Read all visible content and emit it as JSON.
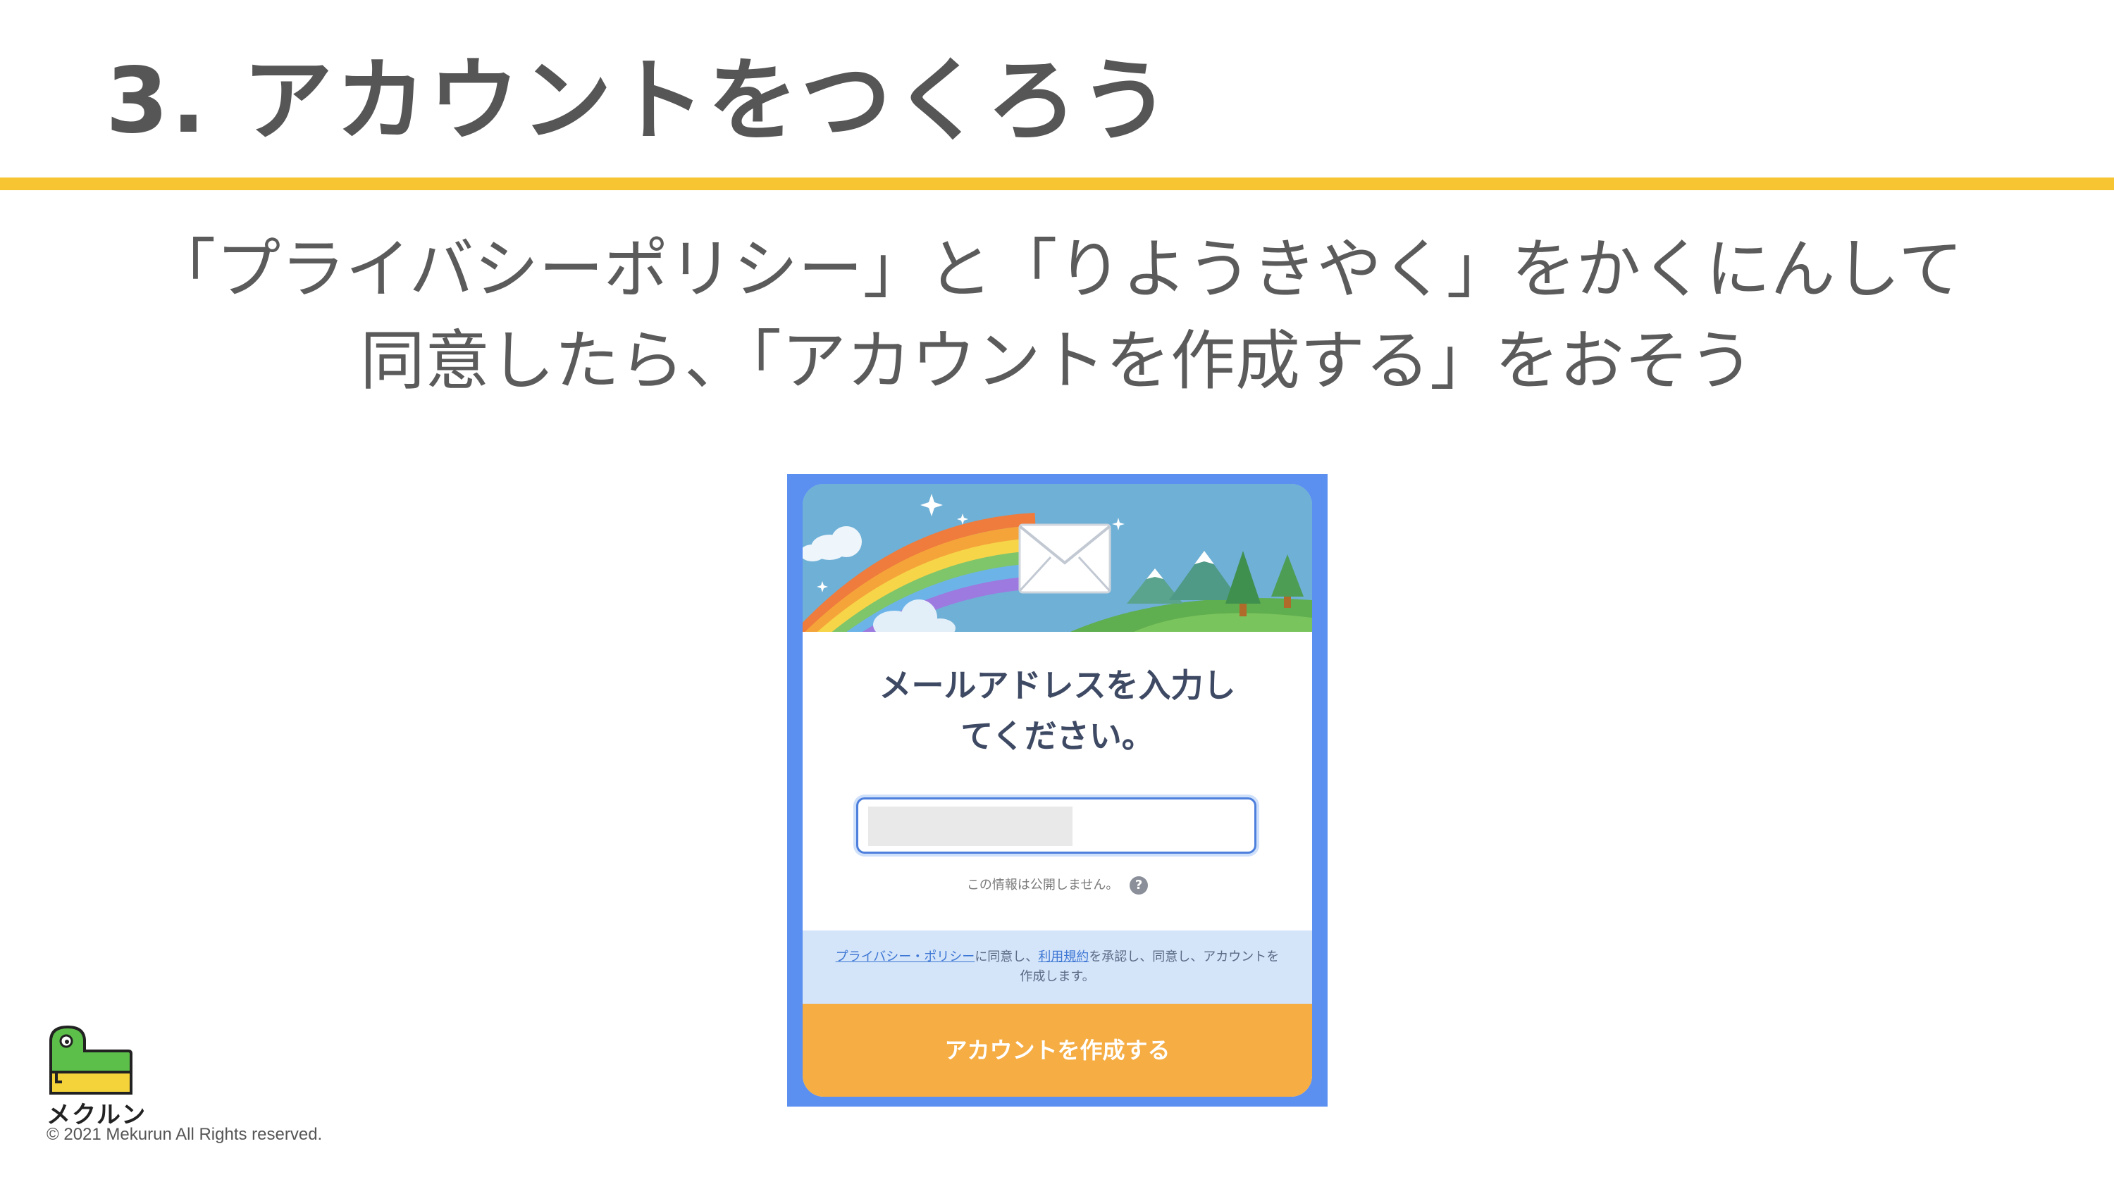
{
  "slide": {
    "title": "3. アカウントをつくろう",
    "instruction_line1": "「プライバシーポリシー」と「りようきやく」をかくにんして",
    "instruction_line2": "同意したら、「アカウントを作成する」をおそう"
  },
  "form": {
    "heading_line1": "メールアドレスを入力し",
    "heading_line2": "てください。",
    "privacy_note": "この情報は公開しません。",
    "help_icon_label": "?",
    "consent": {
      "privacy_link": "プライバシー・ポリシー",
      "text_between": "に同意し、",
      "terms_link": "利用規約",
      "text_after": "を承認し、同意し、アカウントを作成します。"
    },
    "create_button": "アカウントを作成する"
  },
  "brand": {
    "name": "メクルン",
    "copyright": "© 2021 Mekurun All Rights reserved."
  },
  "colors": {
    "accent_rule": "#f7c531",
    "frame": "#5b8ff0",
    "button": "#f5ad44",
    "consent_bg": "#d4e4f9"
  },
  "icons": {
    "help": "question-circle-icon",
    "banner": "rainbow-envelope-illustration",
    "logo": "mekurun-dinosaur-logo"
  }
}
